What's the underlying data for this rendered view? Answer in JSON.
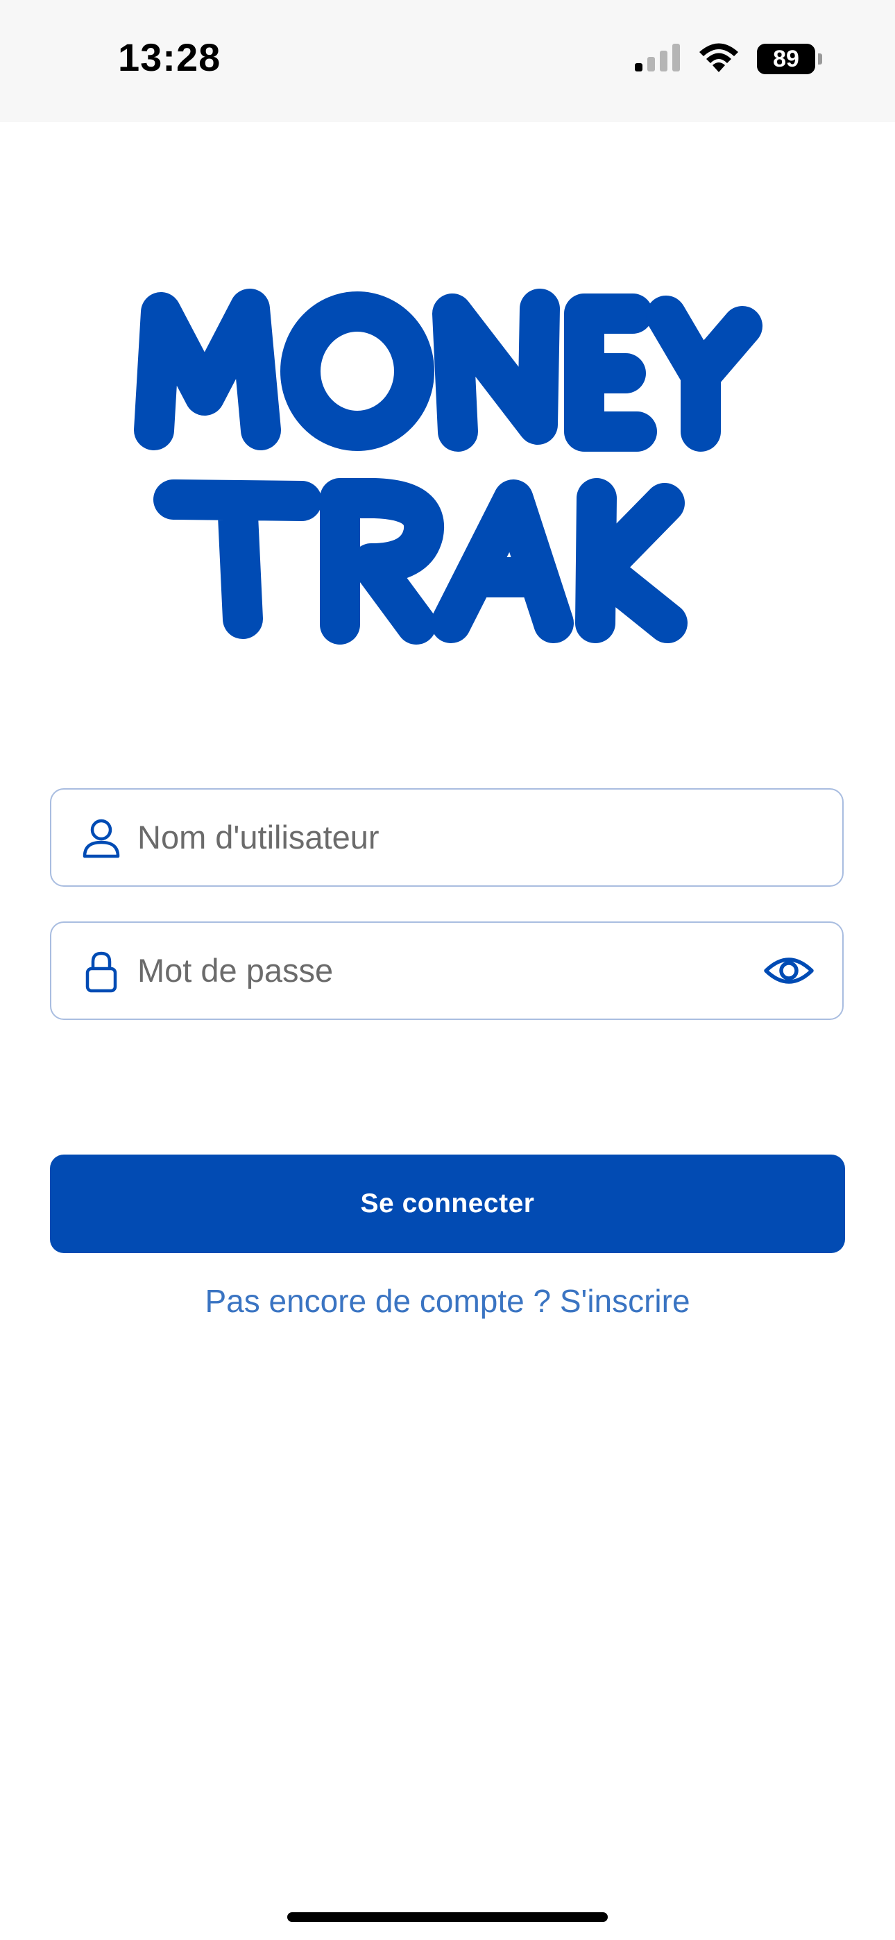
{
  "status_bar": {
    "time": "13:28",
    "battery": "89",
    "icons": [
      "cellular-signal-icon",
      "wifi-icon",
      "battery-icon"
    ]
  },
  "logo": {
    "line1": "MONEY",
    "line2": "TRAK",
    "color": "#004BB4"
  },
  "form": {
    "username_placeholder": "Nom d'utilisateur",
    "username_value": "",
    "password_placeholder": "Mot de passe",
    "password_value": "",
    "icons": {
      "username": "person-icon",
      "password": "lock-icon",
      "toggle": "eye-icon"
    }
  },
  "actions": {
    "login_label": "Se connecter",
    "signup_label": "Pas encore de compte ? S'inscrire"
  },
  "colors": {
    "accent": "#024BB3",
    "link": "#3A74C2",
    "field_border": "#A9BDE0",
    "placeholder": "#6B6B6B"
  }
}
